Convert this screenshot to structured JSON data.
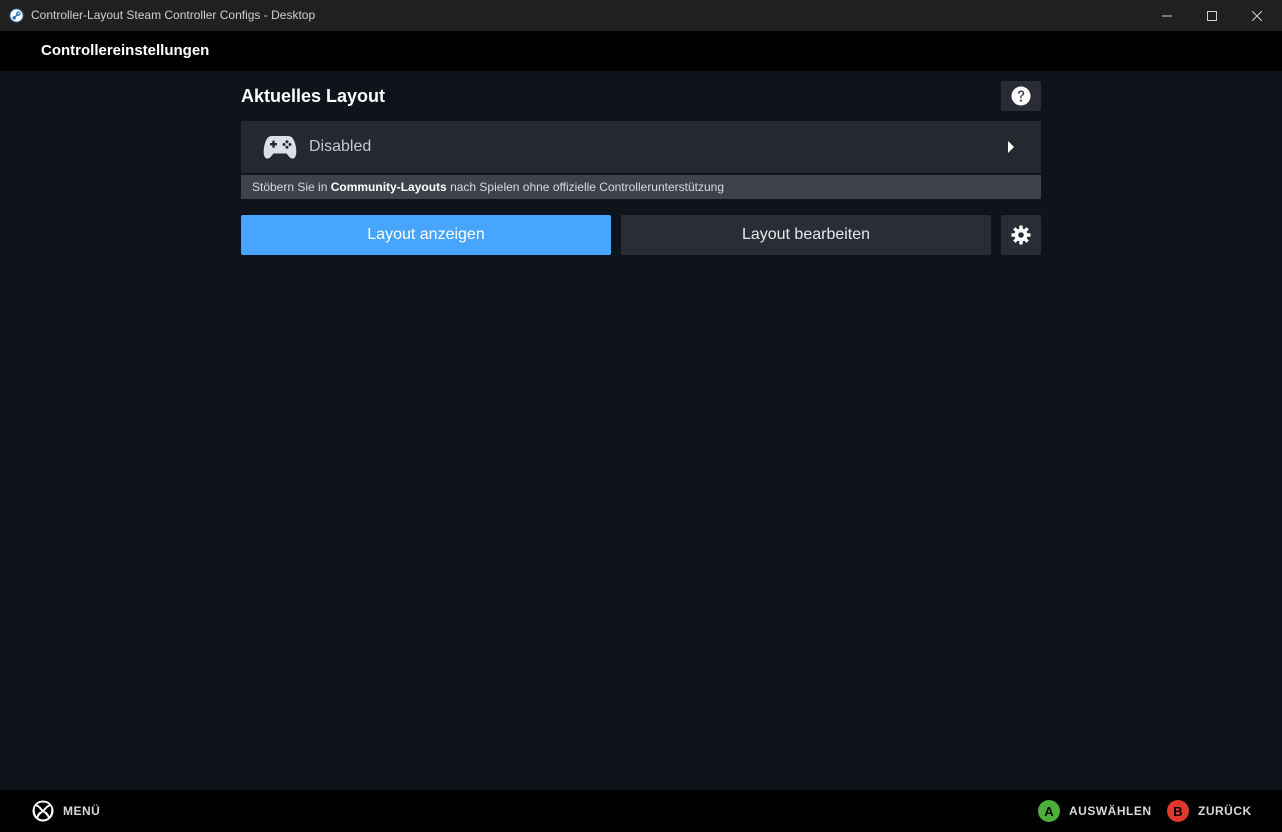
{
  "window": {
    "title": "Controller-Layout Steam Controller Configs - Desktop",
    "icon": "steam-icon",
    "controls": [
      "minimize-icon",
      "maximize-icon",
      "close-icon"
    ]
  },
  "header": {
    "title": "Controllereinstellungen"
  },
  "current_layout": {
    "heading": "Aktuelles Layout",
    "help_icon": "question-icon",
    "layout_name": "Disabled",
    "layout_icon": "gamepad-icon",
    "arrow_icon": "chevron-right-icon",
    "community_prefix": "Stöbern Sie in ",
    "community_link": "Community-Layouts",
    "community_suffix": " nach Spielen ohne offizielle Controllerunterstützung"
  },
  "actions": {
    "show_layout": "Layout anzeigen",
    "edit_layout": "Layout bearbeiten",
    "settings_icon": "gear-icon"
  },
  "footer": {
    "menu_label": "MENÜ",
    "menu_icon": "xbox-icon",
    "select_button": "A",
    "select_label": "AUSWÄHLEN",
    "back_button": "B",
    "back_label": "ZURÜCK"
  },
  "colors": {
    "accent": "#47a5ff",
    "button_a": "#4caf39",
    "button_b": "#e0382c",
    "background": "#0e1118"
  }
}
